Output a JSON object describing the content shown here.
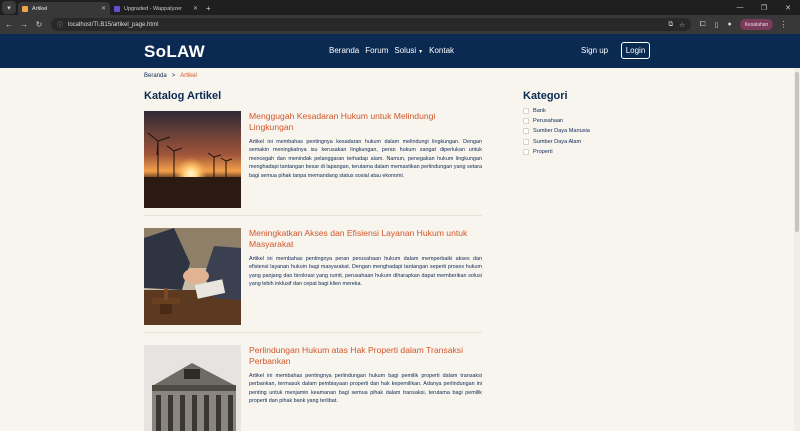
{
  "browser": {
    "tabs": [
      {
        "title": "Artikel",
        "active": true,
        "favicon_color": "#f0a24a"
      },
      {
        "title": "Upgraded - Wappalyzer",
        "active": false,
        "favicon_color": "#6a4bd8"
      }
    ],
    "url": "localhost/TI.B15/artikel_page.html",
    "profile_label": "Kesalahan"
  },
  "site": {
    "logo": "SoLAW",
    "nav": {
      "home": "Beranda",
      "forum": "Forum",
      "solutions": "Solusi",
      "contact": "Kontak"
    },
    "signup": "Sign up",
    "login": "Login"
  },
  "breadcrumb": {
    "home": "Beranda",
    "separator": ">",
    "current": "Artikel"
  },
  "page_title": "Katalog Artikel",
  "articles": [
    {
      "title": "Menggugah Kesadaran Hukum untuk Melindungi Lingkungan",
      "summary": "Artikel ini membahas pentingnya kesadaran hukum dalam melindungi lingkungan. Dengan semakin meningkatnya isu kerusakan lingkungan, peran hukum sangat diperlukan untuk mencegah dan menindak pelanggaran terhadap alam. Namun, penegakan hukum lingkungan menghadapi tantangan besar di lapangan, terutama dalam memastikan perlindungan yang setara bagi semua pihak tanpa memandang status sosial atau ekonomi.",
      "image": "sunset-wind-turbines"
    },
    {
      "title": "Meningkatkan Akses dan Efisiensi Layanan Hukum untuk Masyarakat",
      "summary": "Artikel ini membahas pentingnya peran perusahaan hukum dalam memperbaiki akses dan efisiensi layanan hukum bagi masyarakat. Dengan menghadapi tantangan seperti proses hukum yang panjang dan birokrasi yang rumit, perusahaan hukum diharapkan dapat memberikan solusi yang lebih inklusif dan cepat bagi klien mereka.",
      "image": "handshake-gavel"
    },
    {
      "title": "Perlindungan Hukum atas Hak Properti dalam Transaksi Perbankan",
      "summary": "Artikel ini membahas pentingnya perlindungan hukum bagi pemilik properti dalam transaksi perbankan, termasuk dalam pembiayaan properti dan hak kepemilikan. Adanya perlindungan ini penting untuk menjamin keamanan bagi semua pihak dalam transaksi, terutama bagi pemilik properti dan pihak bank yang terlibat.",
      "image": "classical-bank-building"
    }
  ],
  "sidebar": {
    "title": "Kategori",
    "categories": [
      "Bank",
      "Perusahaan",
      "Sumber Daya Manusia",
      "Sumber Daya Alam",
      "Properti"
    ]
  },
  "colors": {
    "header_bg": "#0b2a52",
    "accent": "#d2572a",
    "page_bg": "#f8f4ee"
  }
}
